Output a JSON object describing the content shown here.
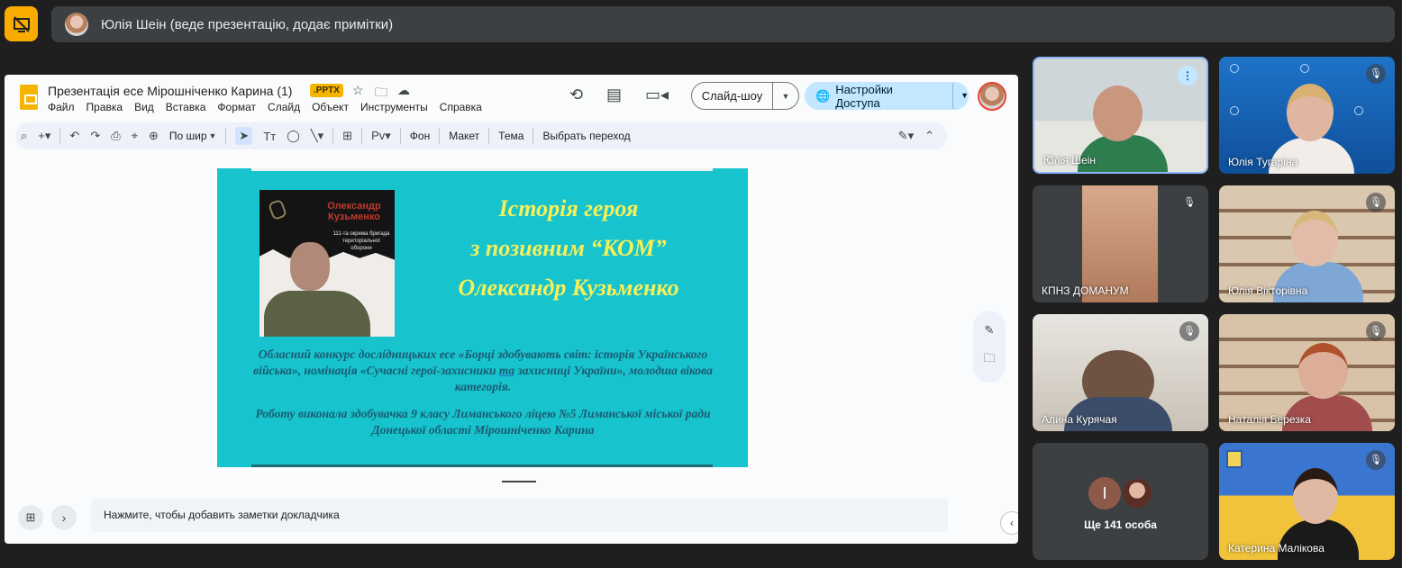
{
  "meet": {
    "presenter_banner": "Юлія Шеін (веде презентацію, додає примітки)"
  },
  "slides_app": {
    "doc_title": "Презентація есе Мірошніченко Карина (1)",
    "file_badge": ".PPTX",
    "menu": [
      "Файл",
      "Правка",
      "Вид",
      "Вставка",
      "Формат",
      "Слайд",
      "Объект",
      "Инструменты",
      "Справка"
    ],
    "slideshow_label": "Слайд-шоу",
    "share_label": "Настройки Доступа",
    "toolbar": {
      "zoom_label": "По шир",
      "background": "Фон",
      "layout": "Макет",
      "theme": "Тема",
      "transition": "Выбрать переход"
    },
    "notes_placeholder": "Нажмите, чтобы добавить заметки докладчика"
  },
  "slide": {
    "photo_name": "Олександр Кузьменко",
    "photo_caption": "111-та окрема бригада територіальної оборони",
    "title_line1": "Історія героя",
    "title_line2": "з позивним “КОМ”",
    "title_line3": "Олександр Кузьменко",
    "body_p1_a": "Обласний конкурс дослідницьких есе «Борці здобувають світ: історія Українського війська», номінація «Сучасні герої-захисники ",
    "body_p1_u": "та",
    "body_p1_b": " захисниці України», молодша вікова категорія.",
    "body_p2": "Роботу виконала здобувачка 9 класу Лиманського ліцею №5 Лиманської міської ради Донецької області  Мірошніченко Карина"
  },
  "participants": [
    {
      "name": "Юлія Шеін"
    },
    {
      "name": "Юлія Тугаріна"
    },
    {
      "name": "КПНЗ ДОМАНУМ"
    },
    {
      "name": "Юлія Вікторівна"
    },
    {
      "name": "Алина Курячая"
    },
    {
      "name": "Наталія Березка"
    },
    {
      "name": "Ще 141 особа",
      "avatar_letter": "І"
    },
    {
      "name": "Катерина Малікова"
    }
  ]
}
